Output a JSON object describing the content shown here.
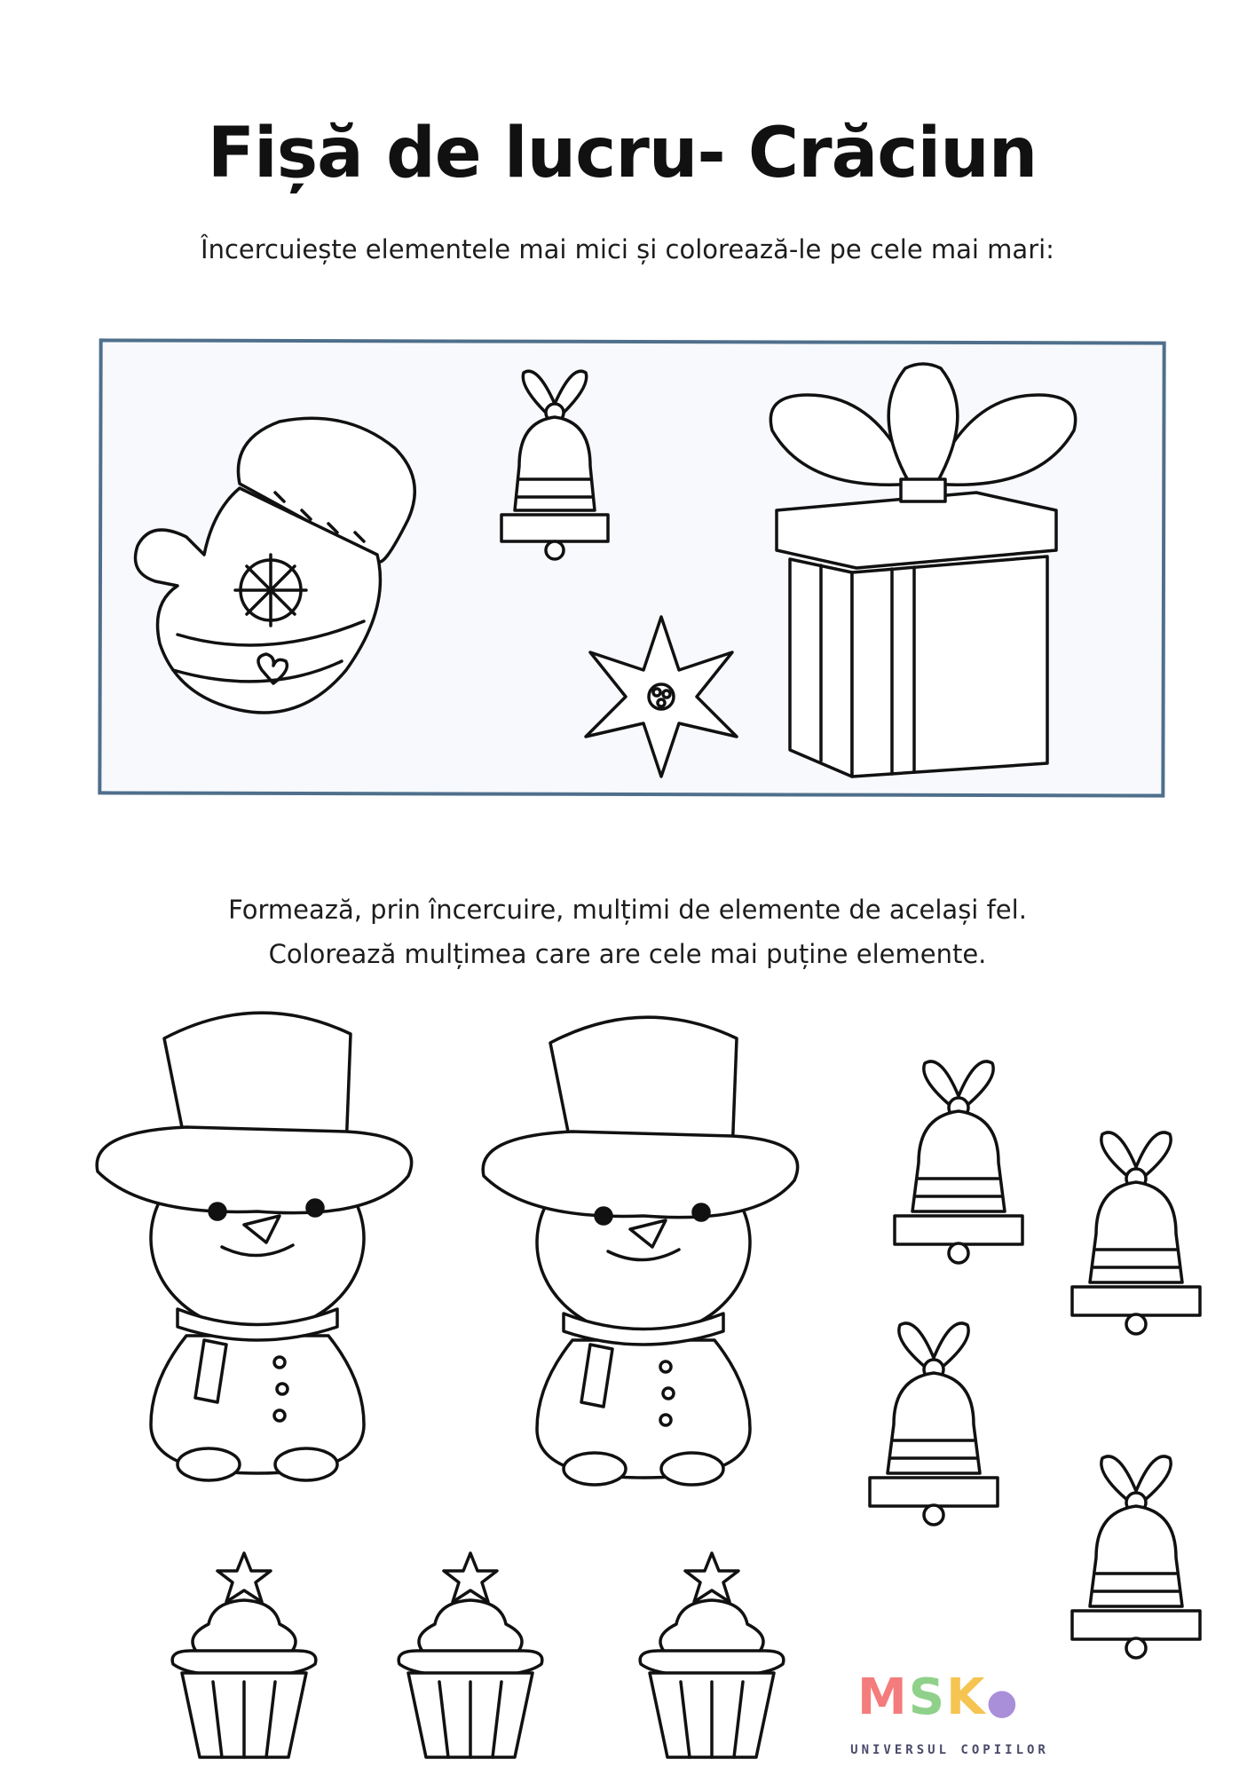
{
  "worksheet": {
    "title": "Fișă de lucru- Crăciun",
    "instruction_1": "Încercuiește elementele mai mici și colorează-le pe cele mai mari:",
    "instruction_2_line_1": "Formează, prin încercuire, mulțimi de elemente de același fel.",
    "instruction_2_line_2": "Colorează mulțimea care are cele mai puține elemente."
  },
  "icons": {
    "section_1": [
      "mitten-icon",
      "small-bell-icon",
      "poinsettia-icon",
      "gift-box-icon"
    ],
    "section_2": [
      "snowman-icon",
      "snowman-icon",
      "bell-icon",
      "bell-icon",
      "bell-icon",
      "bell-icon",
      "cupcake-icon",
      "cupcake-icon",
      "cupcake-icon"
    ]
  },
  "colors": {
    "frame_border": "#4f6f8b",
    "logo_m": "#f47c7c",
    "logo_s": "#8fd18a",
    "logo_k": "#f5c451",
    "logo_feet": "#a98ed9"
  },
  "logo": {
    "letters": [
      "M",
      "S",
      "K"
    ],
    "tagline": "UNIVERSUL COPIILOR"
  }
}
